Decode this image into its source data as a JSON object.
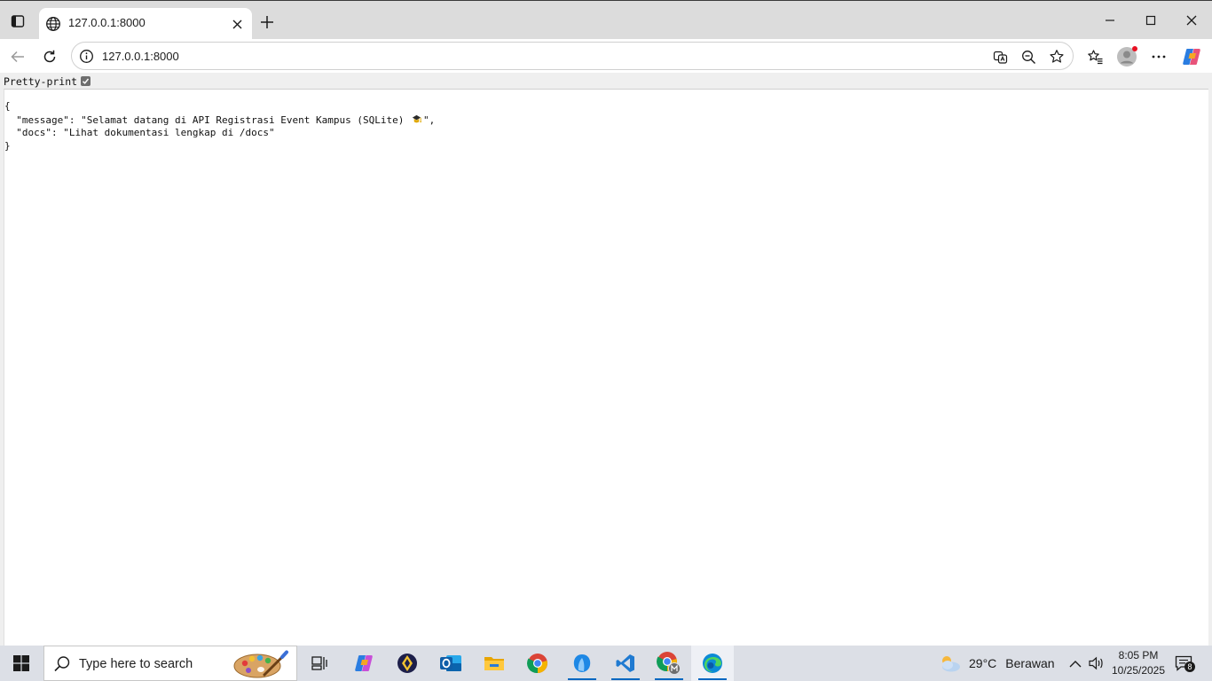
{
  "browser": {
    "tab": {
      "title": "127.0.0.1:8000",
      "icon": "globe-icon"
    },
    "address_bar": {
      "url": "127.0.0.1:8000",
      "icon": "info-icon"
    }
  },
  "viewer": {
    "pretty_print_label": "Pretty-print",
    "pretty_print_checked": true,
    "json_lines": [
      "{",
      "  \"message\": \"Selamat datang di API Registrasi Event Kampus (SQLite) ",
      "\",",
      "  \"docs\": \"Lihat dokumentasi lengkap di /docs\"",
      "}"
    ],
    "message_emoji": "emoji-icon"
  },
  "taskbar": {
    "search_placeholder": "Type here to search",
    "apps": [
      "task-view-icon",
      "copilot-icon",
      "app-icon",
      "outlook-icon",
      "file-explorer-icon",
      "chrome-icon",
      "app-blue-icon",
      "vscode-icon",
      "chrome-profile-icon",
      "edge-icon"
    ],
    "weather": {
      "temp": "29°C",
      "condition": "Berawan"
    },
    "clock": {
      "time": "8:05 PM",
      "date": "10/25/2025"
    },
    "notifications_count": "8"
  },
  "colors": {
    "accent": "#0067c0",
    "titlebar": "#dcdcdc",
    "taskbar": "#dcdfe6"
  }
}
